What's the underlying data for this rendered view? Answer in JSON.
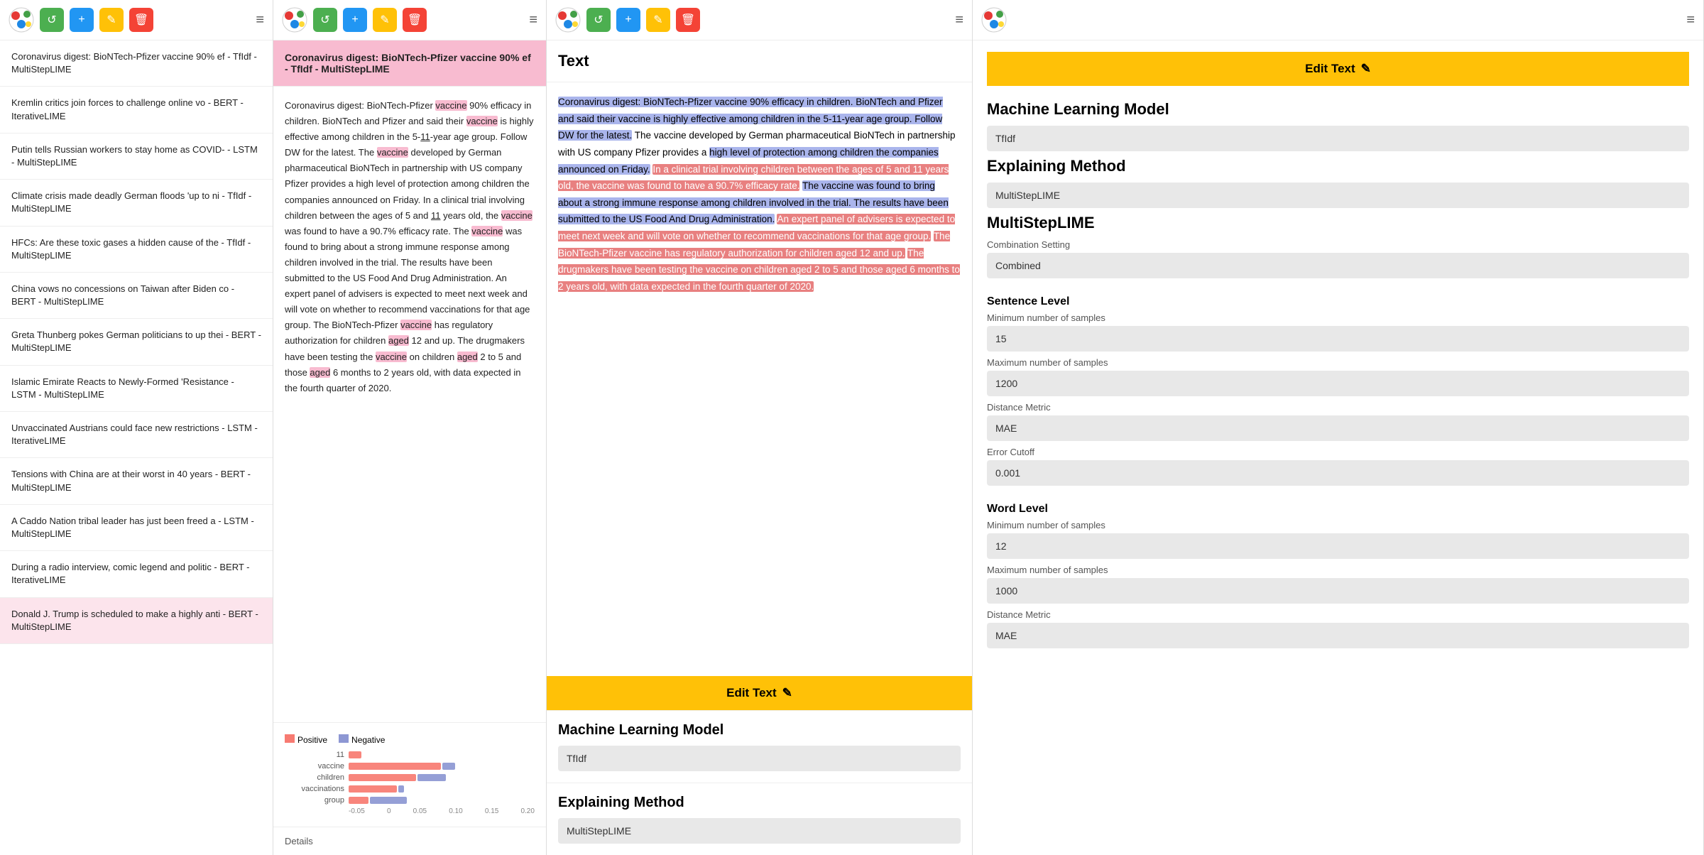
{
  "panels": {
    "panel1": {
      "articles": [
        {
          "title": "Coronavirus digest: BioNTech-Pfizer vaccine 90% ef - TfIdf - MultiStepLIME",
          "selected": false
        },
        {
          "title": "Kremlin critics join forces to challenge online vo - BERT - IterativeLIME",
          "selected": false
        },
        {
          "title": "Putin tells Russian workers to stay home as COVID- - LSTM - MultiStepLIME",
          "selected": false
        },
        {
          "title": "Climate crisis made deadly German floods 'up to ni - TfIdf - MultiStepLIME",
          "selected": false
        },
        {
          "title": "HFCs: Are these toxic gases a hidden cause of the - TfIdf - MultiStepLIME",
          "selected": false
        },
        {
          "title": "China vows no concessions on Taiwan after Biden co - BERT - MultiStepLIME",
          "selected": false
        },
        {
          "title": "Greta Thunberg pokes German politicians to up thei - BERT - MultiStepLIME",
          "selected": false
        },
        {
          "title": "Islamic Emirate Reacts to Newly-Formed 'Resistance - LSTM - MultiStepLIME",
          "selected": false
        },
        {
          "title": "Unvaccinated Austrians could face new restrictions - LSTM - IterativeLIME",
          "selected": false
        },
        {
          "title": "Tensions with China are at their worst in 40 years - BERT - MultiStepLIME",
          "selected": false
        },
        {
          "title": "A Caddo Nation tribal leader has just been freed a - LSTM - MultiStepLIME",
          "selected": false
        },
        {
          "title": "During a radio interview, comic legend and politic - BERT - IterativeLIME",
          "selected": false
        },
        {
          "title": "Donald J. Trump is scheduled to make a highly anti - BERT - MultiStepLIME",
          "selected": false
        }
      ]
    },
    "panel2": {
      "article_title": "Coronavirus digest: BioNTech-Pfizer vaccine 90% ef - TfIdf - MultiStepLIME",
      "article_body": "Coronavirus digest: BioNTech-Pfizer vaccine 90% efficacy in children. BioNTech and Pfizer and said their vaccine is highly effective among children in the 5-11-year age group. Follow DW for the latest. The vaccine developed by German pharmaceutical BioNTech in partnership with US company Pfizer provides a high level of protection among children the companies announced on Friday. In a clinical trial involving children between the ages of 5 and 11 years old, the vaccine was found to have a 90.7% efficacy rate. The vaccine was found to bring about a strong immune response among children involved in the trial. The results have been submitted to the US Food And Drug Administration. An expert panel of advisers is expected to meet next week and will vote on whether to recommend vaccinations for that age group. The BioNTech-Pfizer vaccine has regulatory authorization for children aged 12 and up. The drugmakers have been testing the vaccine on children aged 2 to 5 and those aged 6 months to 2 years old, with data expected in the fourth quarter of 2020.",
      "chart": {
        "legend_positive": "Positive",
        "legend_negative": "Negative",
        "rows": [
          {
            "label": "11",
            "pos": 15,
            "neg": 0
          },
          {
            "label": "vaccine",
            "pos": 130,
            "neg": 20
          },
          {
            "label": "children",
            "pos": 95,
            "neg": 45
          },
          {
            "label": "vaccinations",
            "pos": 70,
            "neg": 10
          },
          {
            "label": "group",
            "pos": 30,
            "neg": 55
          }
        ],
        "axis_labels": [
          "-0.05",
          "0",
          "0.05",
          "0.10",
          "0.15",
          "0.20"
        ]
      },
      "details_label": "Details"
    },
    "panel3": {
      "header": "Text",
      "edit_text_btn": "Edit Text",
      "machine_learning_label": "Machine Learning Model",
      "machine_learning_value": "TfIdf",
      "explaining_method_label": "Explaining Method",
      "explaining_method_value": "MultiStepLIME"
    },
    "panel4": {
      "edit_text_btn": "Edit Text",
      "machine_learning_label": "Machine Learning Model",
      "machine_learning_value": "TfIdf",
      "explaining_method_label": "Explaining Method",
      "explaining_method_value": "MultiStepLIME",
      "multisteplime_label": "MultiStepLIME",
      "combination_setting_label": "Combination Setting",
      "combination_setting_value": "Combined",
      "sentence_level_label": "Sentence Level",
      "sentence_min_label": "Minimum number of samples",
      "sentence_min_value": "15",
      "sentence_max_label": "Maximum number of samples",
      "sentence_max_value": "1200",
      "sentence_distance_label": "Distance Metric",
      "sentence_distance_value": "MAE",
      "sentence_error_label": "Error Cutoff",
      "sentence_error_value": "0.001",
      "word_level_label": "Word Level",
      "word_min_label": "Minimum number of samples",
      "word_min_value": "12",
      "word_max_label": "Maximum number of samples",
      "word_max_value": "1000",
      "word_distance_label": "Distance Metric",
      "word_distance_value": "MAE"
    }
  },
  "toolbar": {
    "refresh_label": "↺",
    "add_label": "+",
    "edit_label": "✎",
    "delete_label": "🗑",
    "menu_label": "≡"
  }
}
